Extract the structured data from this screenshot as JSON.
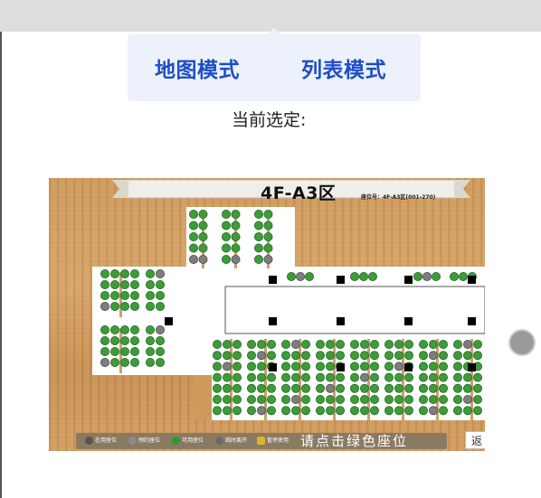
{
  "modes": {
    "map_label": "地图模式",
    "list_label": "列表模式"
  },
  "current_selection_label": "当前选定:",
  "floor": {
    "title": "4F-A3区",
    "subtitle": "座位号：4F-A3区(001-270)"
  },
  "legend": {
    "items": [
      {
        "label": "在用座位",
        "color": "#555555"
      },
      {
        "label": "预约座位",
        "color": "#8c8c8c"
      },
      {
        "label": "可用座位",
        "color": "#2f9a2f"
      },
      {
        "label": "临时离开",
        "color": "#6b6b6b"
      },
      {
        "label": "暂停使用",
        "color": "#e0b030"
      }
    ],
    "hint": "请点击绿色座位"
  },
  "back_label": "返"
}
